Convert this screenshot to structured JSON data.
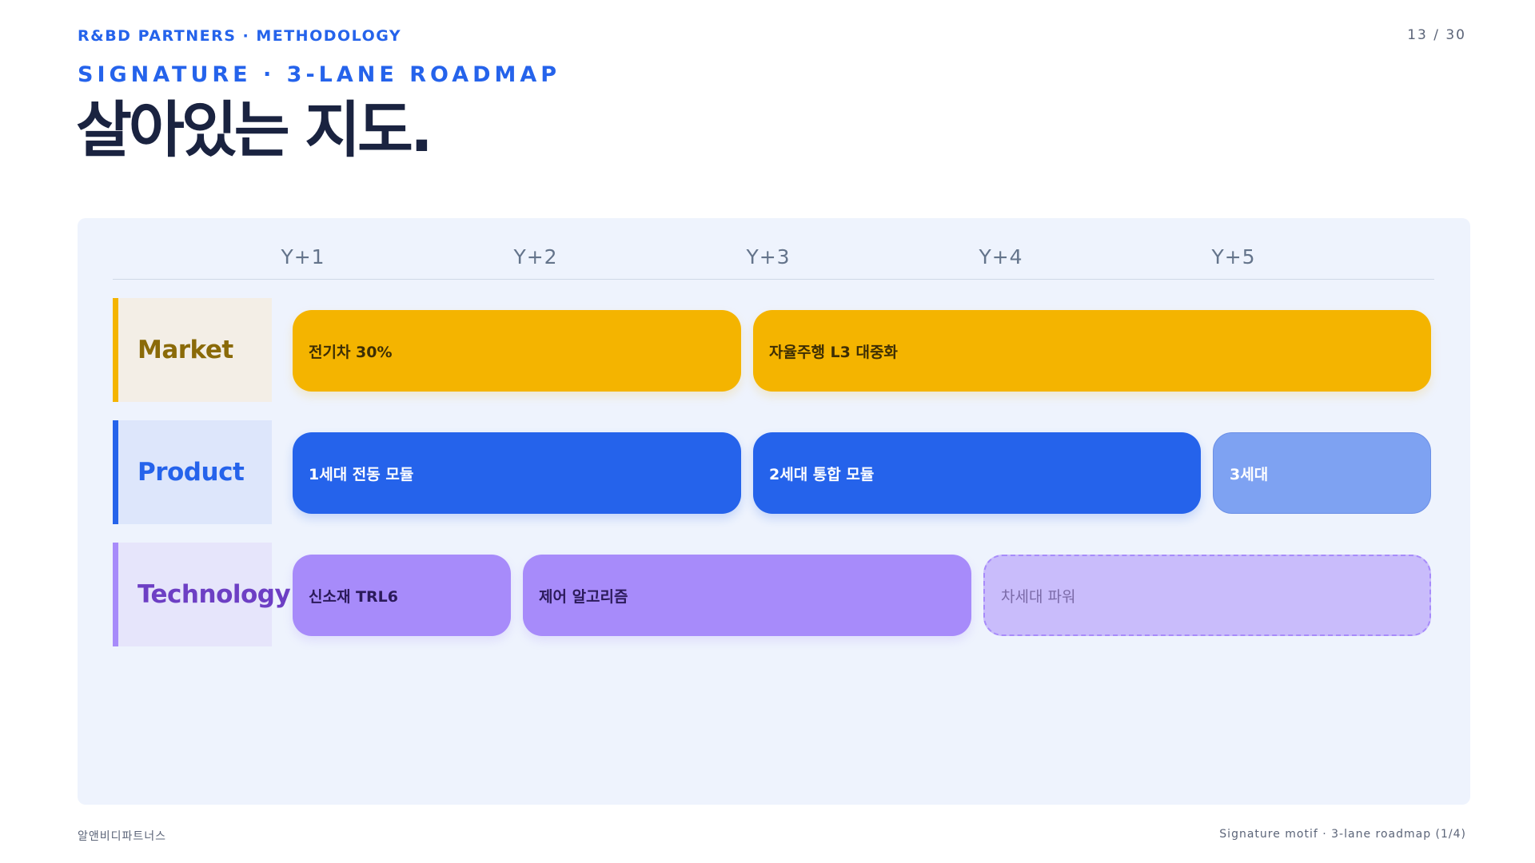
{
  "header": {
    "brand": "R&BD PARTNERS · METHODOLOGY",
    "page": "13 / 30",
    "subtitle": "SIGNATURE · 3-LANE ROADMAP",
    "title": "살아있는 지도."
  },
  "roadmap": {
    "years": [
      "Y+1",
      "Y+2",
      "Y+3",
      "Y+4",
      "Y+5"
    ],
    "lanes": [
      {
        "label": "Market",
        "color": "#f4b400",
        "items": [
          {
            "label": "전기차 30%",
            "start_year": 1,
            "end_year": 2
          },
          {
            "label": "자율주행 L3 대중화",
            "start_year": 3,
            "end_year": 5
          }
        ]
      },
      {
        "label": "Product",
        "color": "#2563eb",
        "items": [
          {
            "label": "1세대 전동 모듈",
            "start_year": 1,
            "end_year": 2
          },
          {
            "label": "2세대 통합 모듈",
            "start_year": 3,
            "end_year": 4
          },
          {
            "label": "3세대",
            "start_year": 5,
            "end_year": 5,
            "style": "faded"
          }
        ]
      },
      {
        "label": "Technology",
        "color": "#a78bfa",
        "items": [
          {
            "label": "신소재 TRL6",
            "start_year": 1,
            "end_year": 1
          },
          {
            "label": "제어 알고리즘",
            "start_year": 2,
            "end_year": 3
          },
          {
            "label": "차세대 파워",
            "start_year": 4,
            "end_year": 5,
            "style": "dashed"
          }
        ]
      }
    ]
  },
  "footer": {
    "left": "알앤비디파트너스",
    "right": "Signature motif · 3-lane roadmap (1/4)"
  }
}
